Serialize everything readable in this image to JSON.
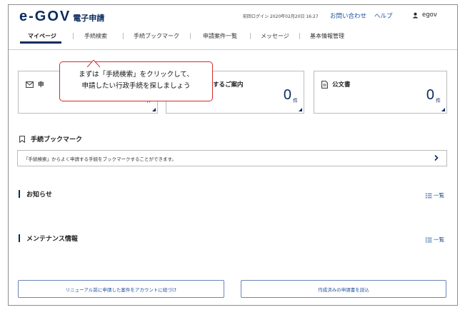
{
  "header": {
    "logo_mark": "e-GOV",
    "logo_sub": "電子申請",
    "last_login": "前回ログイン 2020年02月20日 16:27",
    "contact": "お問い合わせ",
    "help": "ヘルプ",
    "user_name": "egov"
  },
  "nav": {
    "tabs": [
      {
        "label": "マイページ",
        "active": true
      },
      {
        "label": "手続検索"
      },
      {
        "label": "手続ブックマーク"
      },
      {
        "label": "申請案件一覧"
      },
      {
        "label": "メッセージ"
      },
      {
        "label": "基本情報管理"
      }
    ]
  },
  "tooltip": {
    "line1": "まずは「手続検索」をクリックして、",
    "line2": "申請したい行政手続を探しましょう"
  },
  "cards": [
    {
      "title": "申",
      "count": "",
      "unit": "件",
      "icon": "mail-icon"
    },
    {
      "title": "に関するご案内",
      "count": "0",
      "unit": "件",
      "icon": ""
    },
    {
      "title": "公文書",
      "count": "0",
      "unit": "件",
      "icon": "document-icon"
    }
  ],
  "bookmark": {
    "title": "手続ブックマーク",
    "text": "「手続検索」からよく申請する手続をブックマークすることができます。",
    "icon": "bookmark-icon"
  },
  "notices": {
    "title": "お知らせ",
    "link": "一覧"
  },
  "maintenance": {
    "title": "メンテナンス情報",
    "link": "一覧"
  },
  "buttons": {
    "link_account": "リニューアル前に申請した案件をアカウントに紐づけ",
    "load_application": "作成済みの申請書を読込"
  },
  "colors": {
    "brand": "#0a2b5e",
    "link": "#1a4f9c",
    "callout_border": "#d22b2b"
  }
}
